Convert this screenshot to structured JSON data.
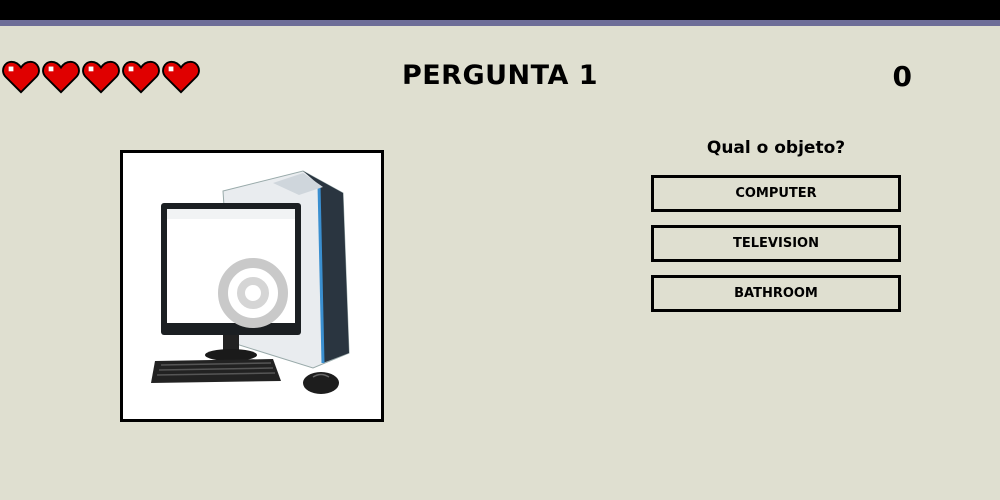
{
  "game": {
    "title": "PERGUNTA 1",
    "score": "0",
    "lives": 5,
    "heart_color": "#e00000"
  },
  "question": {
    "prompt": "Qual o objeto?",
    "image_icon": "desktop-computer-icon"
  },
  "answers": [
    {
      "label": "COMPUTER"
    },
    {
      "label": "TELEVISION"
    },
    {
      "label": "BATHROOM"
    }
  ]
}
